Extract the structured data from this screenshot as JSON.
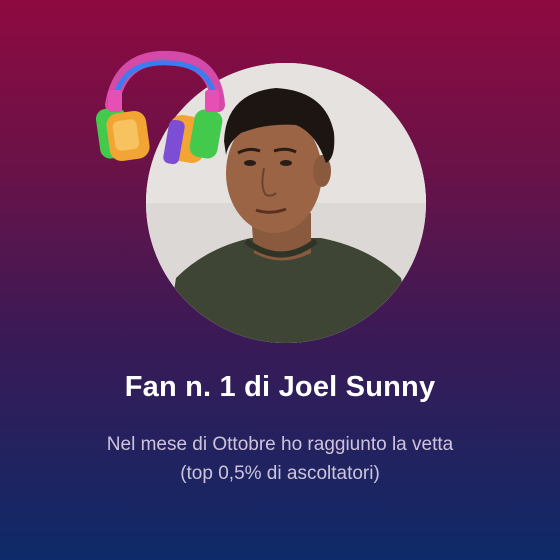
{
  "card": {
    "title": "Fan n. 1 di Joel Sunny",
    "subtitle_line1": "Nel mese di Ottobre ho raggiunto la vetta",
    "subtitle_line2": "(top 0,5% di ascoltatori)"
  },
  "icons": {
    "sticker": "headphones-icon",
    "photo": "artist-avatar"
  },
  "colors": {
    "background_top": "#8d0a40",
    "background_bottom": "#0d2a68",
    "title": "#ffffff",
    "subtitle": "#cdc4dc"
  }
}
